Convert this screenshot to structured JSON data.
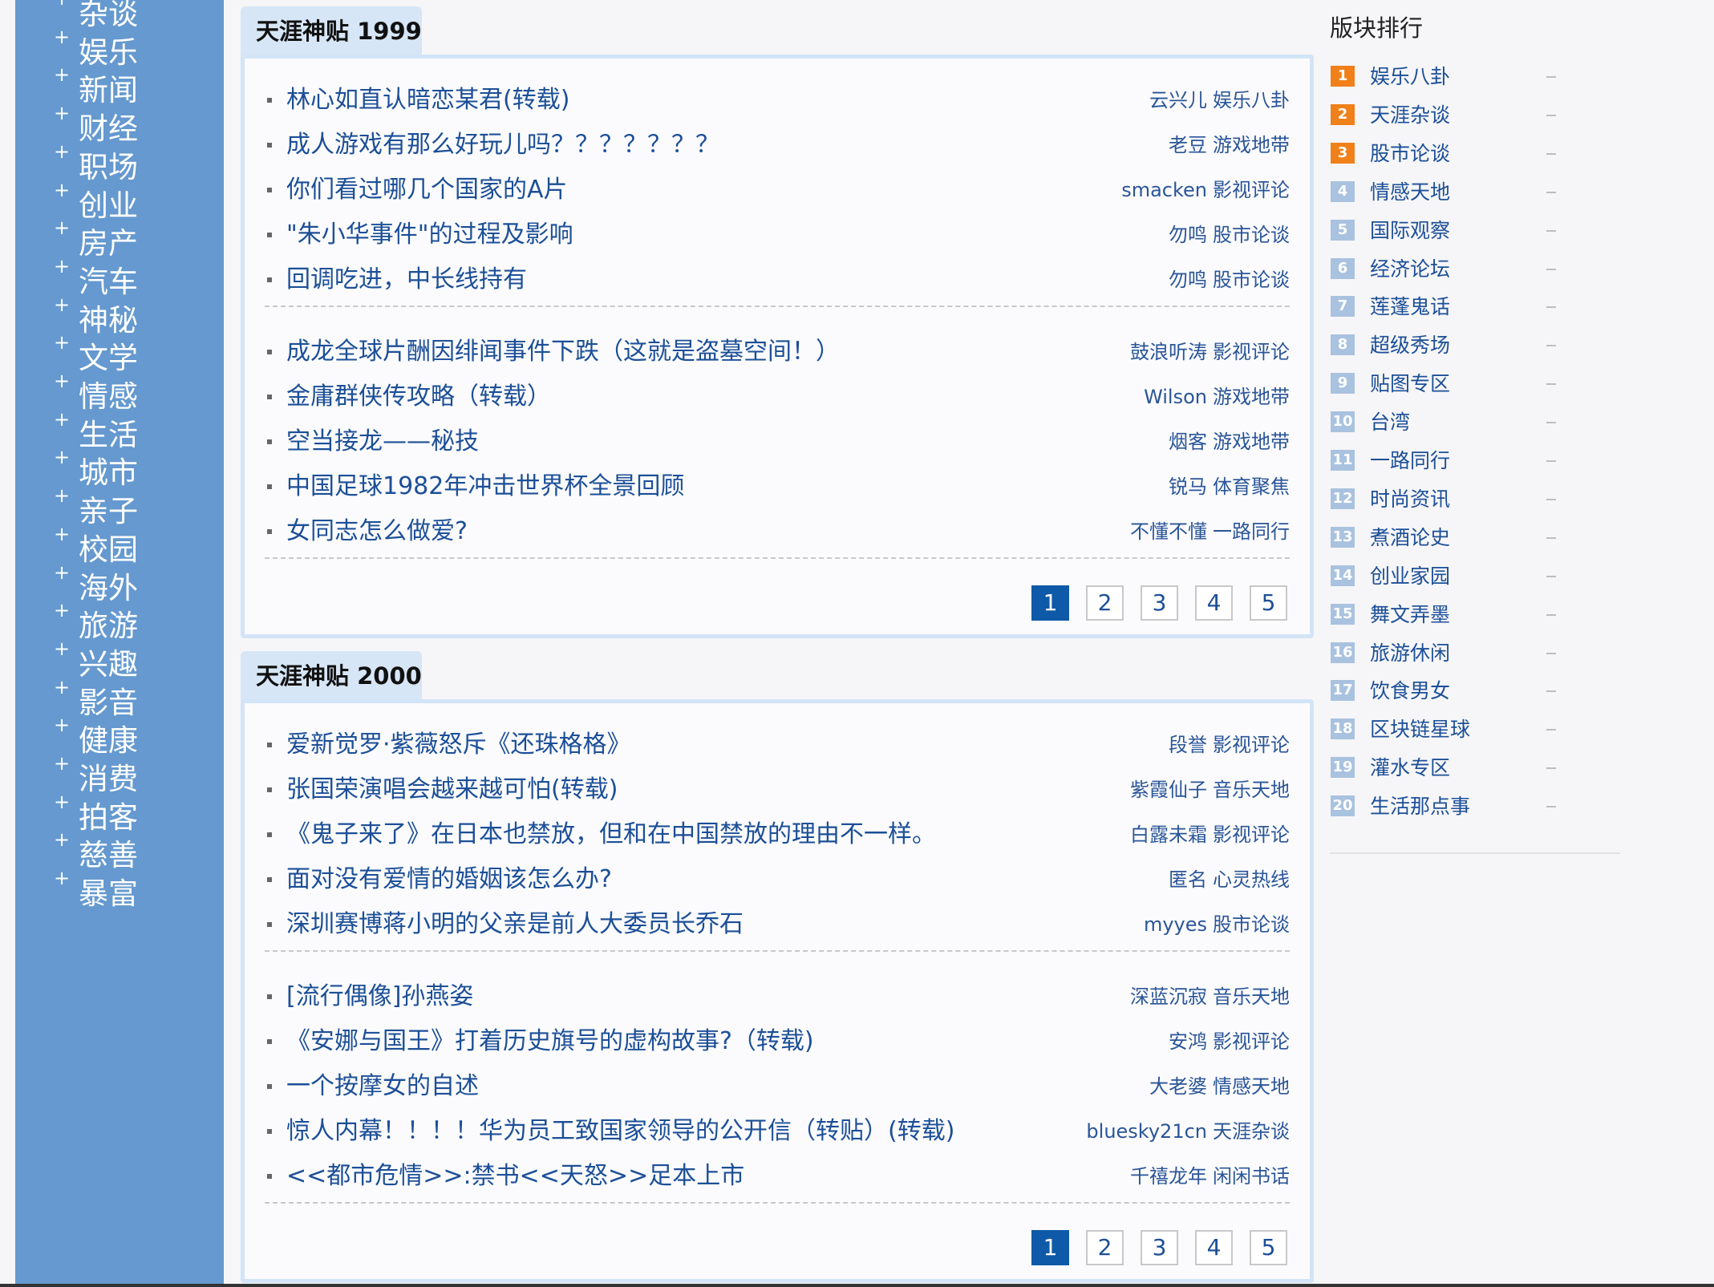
{
  "sidebar": {
    "categories": [
      "杂谈",
      "娱乐",
      "新闻",
      "财经",
      "职场",
      "创业",
      "房产",
      "汽车",
      "神秘",
      "文学",
      "情感",
      "生活",
      "城市",
      "亲子",
      "校园",
      "海外",
      "旅游",
      "兴趣",
      "影音",
      "健康",
      "消费",
      "拍客",
      "慈善",
      "暴富"
    ]
  },
  "sections": [
    {
      "title": "天涯神贴 1999",
      "groups": [
        [
          {
            "title": "林心如直认暗恋某君(转载)",
            "author": "云兴儿",
            "board": "娱乐八卦"
          },
          {
            "title": "成人游戏有那么好玩儿吗？？？？？？？",
            "author": "老豆",
            "board": "游戏地带"
          },
          {
            "title": "你们看过哪几个国家的A片",
            "author": "smacken",
            "board": "影视评论"
          },
          {
            "title": "\"朱小华事件\"的过程及影响",
            "author": "勿鸣",
            "board": "股市论谈"
          },
          {
            "title": "回调吃进，中长线持有",
            "author": "勿鸣",
            "board": "股市论谈"
          }
        ],
        [
          {
            "title": "成龙全球片酬因绯闻事件下跌（这就是盗墓空间！）",
            "author": "鼓浪听涛",
            "board": "影视评论"
          },
          {
            "title": "金庸群侠传攻略（转载）",
            "author": "Wilson",
            "board": "游戏地带"
          },
          {
            "title": "空当接龙——秘技",
            "author": "烟客",
            "board": "游戏地带"
          },
          {
            "title": "中国足球1982年冲击世界杯全景回顾",
            "author": "锐马",
            "board": "体育聚焦"
          },
          {
            "title": "女同志怎么做爱?",
            "author": "不懂不懂",
            "board": "一路同行"
          }
        ]
      ],
      "pages": [
        "1",
        "2",
        "3",
        "4",
        "5"
      ],
      "active_page": "1"
    },
    {
      "title": "天涯神贴 2000",
      "groups": [
        [
          {
            "title": "爱新觉罗·紫薇怒斥《还珠格格》",
            "author": "段誉",
            "board": "影视评论"
          },
          {
            "title": "张国荣演唱会越来越可怕(转载)",
            "author": "紫霞仙子",
            "board": "音乐天地"
          },
          {
            "title": "《鬼子来了》在日本也禁放，但和在中国禁放的理由不一样。",
            "author": "白露未霜",
            "board": "影视评论"
          },
          {
            "title": "面对没有爱情的婚姻该怎么办?",
            "author": "匿名",
            "board": "心灵热线"
          },
          {
            "title": "深圳赛博蒋小明的父亲是前人大委员长乔石",
            "author": "myyes",
            "board": "股市论谈"
          }
        ],
        [
          {
            "title": "[流行偶像]孙燕姿",
            "author": "深蓝沉寂",
            "board": "音乐天地"
          },
          {
            "title": "《安娜与国王》打着历史旗号的虚构故事?（转载)",
            "author": "安鸿",
            "board": "影视评论"
          },
          {
            "title": "一个按摩女的自述",
            "author": "大老婆",
            "board": "情感天地"
          },
          {
            "title": "惊人内幕！！！！华为员工致国家领导的公开信（转贴）(转载)",
            "author": "bluesky21cn",
            "board": "天涯杂谈"
          },
          {
            "title": "<<都市危情>>:禁书<<天怒>>足本上市",
            "author": "千禧龙年",
            "board": "闲闲书话"
          }
        ]
      ],
      "pages": [
        "1",
        "2",
        "3",
        "4",
        "5"
      ],
      "active_page": "1"
    }
  ],
  "ranking": {
    "title": "版块排行",
    "items": [
      {
        "rank": "1",
        "name": "娱乐八卦",
        "trend": "—"
      },
      {
        "rank": "2",
        "name": "天涯杂谈",
        "trend": "—"
      },
      {
        "rank": "3",
        "name": "股市论谈",
        "trend": "—"
      },
      {
        "rank": "4",
        "name": "情感天地",
        "trend": "—"
      },
      {
        "rank": "5",
        "name": "国际观察",
        "trend": "—"
      },
      {
        "rank": "6",
        "name": "经济论坛",
        "trend": "—"
      },
      {
        "rank": "7",
        "name": "莲蓬鬼话",
        "trend": "—"
      },
      {
        "rank": "8",
        "name": "超级秀场",
        "trend": "—"
      },
      {
        "rank": "9",
        "name": "贴图专区",
        "trend": "—"
      },
      {
        "rank": "10",
        "name": "台湾",
        "trend": "—"
      },
      {
        "rank": "11",
        "name": "一路同行",
        "trend": "—"
      },
      {
        "rank": "12",
        "name": "时尚资讯",
        "trend": "—"
      },
      {
        "rank": "13",
        "name": "煮酒论史",
        "trend": "—"
      },
      {
        "rank": "14",
        "name": "创业家园",
        "trend": "—"
      },
      {
        "rank": "15",
        "name": "舞文弄墨",
        "trend": "—"
      },
      {
        "rank": "16",
        "name": "旅游休闲",
        "trend": "—"
      },
      {
        "rank": "17",
        "name": "饮食男女",
        "trend": "—"
      },
      {
        "rank": "18",
        "name": "区块链星球",
        "trend": "—"
      },
      {
        "rank": "19",
        "name": "灌水专区",
        "trend": "—"
      },
      {
        "rank": "20",
        "name": "生活那点事",
        "trend": "—"
      }
    ],
    "colors": {
      "top": "#f0801a",
      "rest": "#a9c2df"
    }
  }
}
